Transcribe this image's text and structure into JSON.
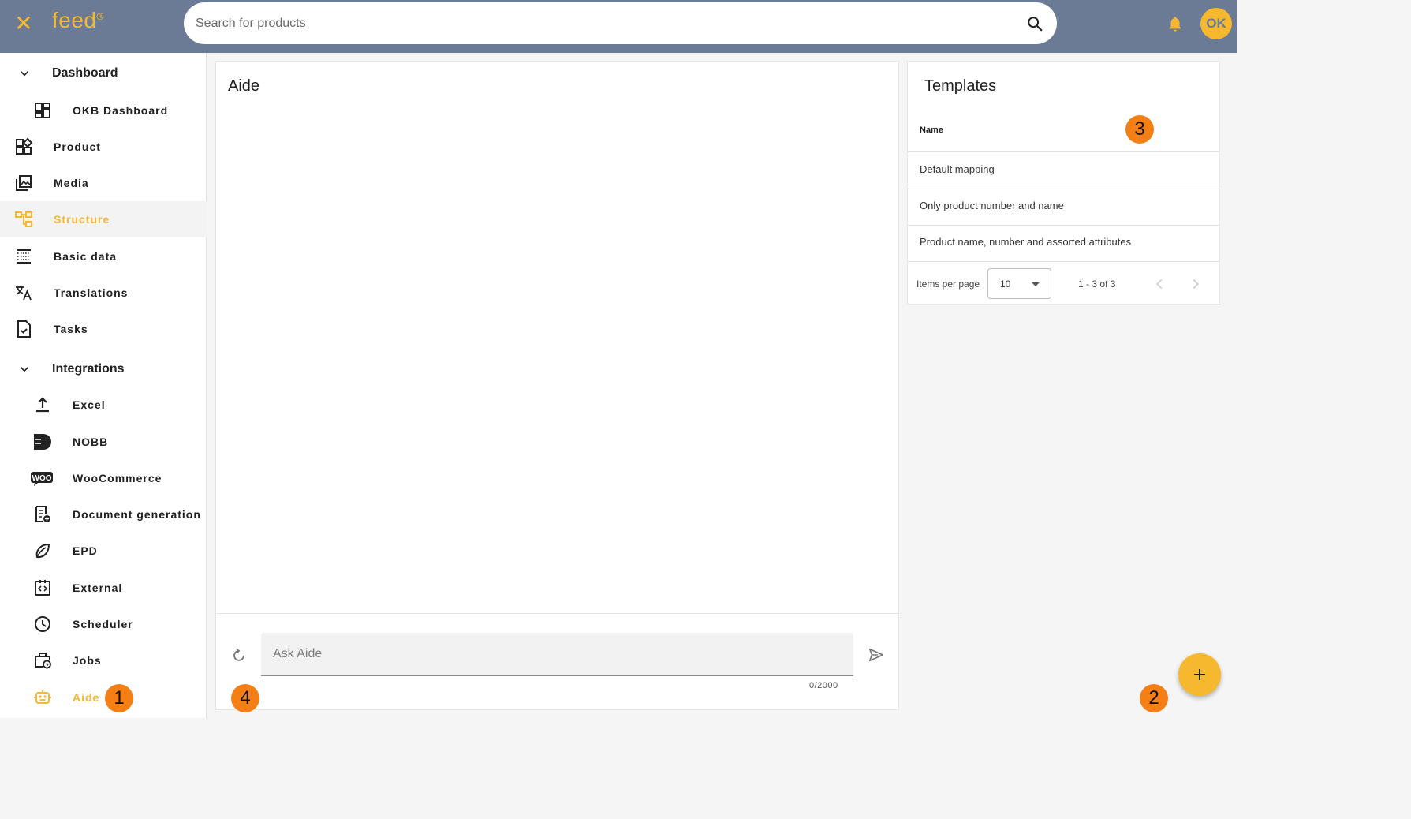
{
  "header": {
    "close_icon": "close-icon",
    "logo_text": "feed",
    "logo_mark": "®",
    "search_placeholder": "Search for products",
    "notifications_icon": "bell-icon",
    "avatar_initials": "OK"
  },
  "sidebar": {
    "dashboard_group": "Dashboard",
    "integrations_group": "Integrations",
    "items": [
      {
        "label": "OKB Dashboard",
        "icon": "dashboard-icon"
      },
      {
        "label": "Product",
        "icon": "widgets-icon"
      },
      {
        "label": "Media",
        "icon": "photo-library-icon"
      },
      {
        "label": "Structure",
        "icon": "account-tree-icon",
        "active": true
      },
      {
        "label": "Basic data",
        "icon": "list-icon"
      },
      {
        "label": "Translations",
        "icon": "translate-icon"
      },
      {
        "label": "Tasks",
        "icon": "task-icon"
      },
      {
        "label": "Excel",
        "icon": "upload-icon"
      },
      {
        "label": "NOBB",
        "icon": "nobb-icon"
      },
      {
        "label": "WooCommerce",
        "icon": "woo-icon"
      },
      {
        "label": "Document generation",
        "icon": "document-add-icon"
      },
      {
        "label": "EPD",
        "icon": "leaf-icon"
      },
      {
        "label": "External",
        "icon": "external-code-icon"
      },
      {
        "label": "Scheduler",
        "icon": "clock-icon"
      },
      {
        "label": "Jobs",
        "icon": "work-history-icon"
      },
      {
        "label": "Aide",
        "icon": "robot-icon",
        "highlight": true
      }
    ]
  },
  "aide": {
    "title": "Aide",
    "input_placeholder": "Ask Aide",
    "counter": "0/2000"
  },
  "templates": {
    "title": "Templates",
    "column_name": "Name",
    "rows": [
      "Default mapping",
      "Only product number and name",
      "Product name, number and assorted attributes"
    ],
    "paginator": {
      "items_per_page_label": "Items per page",
      "page_size": "10",
      "range": "1 - 3 of 3"
    }
  },
  "markers": [
    "1",
    "2",
    "3",
    "4"
  ],
  "colors": {
    "header_bg": "#6b7b96",
    "accent": "#f5b82e",
    "marker": "#f57f17"
  }
}
